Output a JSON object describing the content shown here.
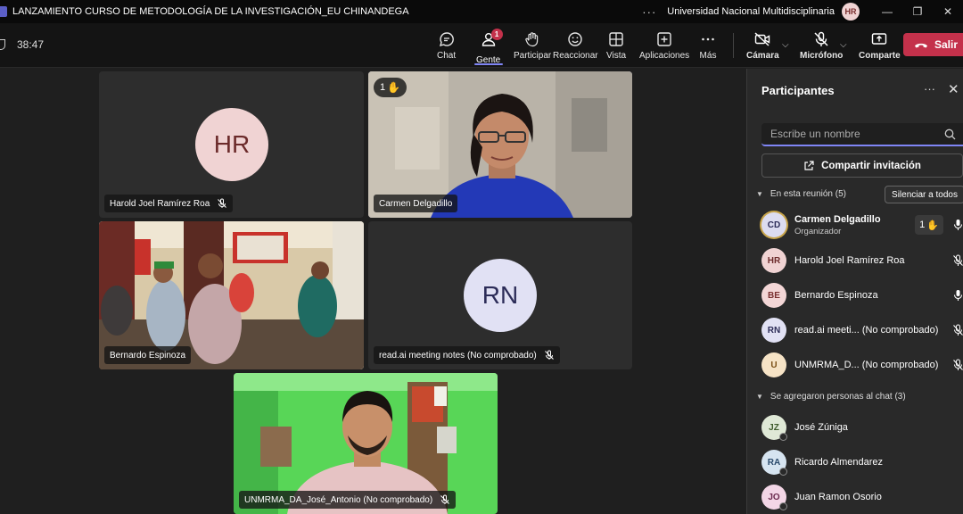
{
  "window": {
    "title": "LANZAMIENTO CURSO DE METODOLOGÍA DE LA INVESTIGACIÓN_EU CHINANDEGA",
    "more": "···",
    "org": "Universidad Nacional Multidisciplinaria",
    "user_initials": "HR",
    "minimize": "—",
    "restore": "❐",
    "close": "✕"
  },
  "toolbar": {
    "timer": "38:47",
    "chat": "Chat",
    "people": "Gente",
    "people_badge": "1",
    "raise": "Participar",
    "react": "Reaccionar",
    "view": "Vista",
    "apps": "Aplicaciones",
    "more": "Más",
    "camera": "Cámara",
    "mic": "Micrófono",
    "share": "Comparte",
    "leave": "Salir"
  },
  "stage": {
    "tiles": [
      {
        "name": "Harold Joel Ramírez Roa",
        "initials": "HR"
      },
      {
        "name": "Carmen Delgadillo",
        "hand": "1"
      },
      {
        "name": "Bernardo Espinoza"
      },
      {
        "name": "read.ai meeting notes (No comprobado)",
        "initials": "RN"
      },
      {
        "name": "UNMRMA_DA_José_Antonio (No comprobado)"
      }
    ]
  },
  "panel": {
    "title": "Participantes",
    "more": "···",
    "close": "✕",
    "search_placeholder": "Escribe un nombre",
    "share_invite": "Compartir invitación",
    "in_meeting": "En esta reunión (5)",
    "mute_all": "Silenciar a todos",
    "in_meeting_list": [
      {
        "initials": "CD",
        "name": "Carmen Delgadillo",
        "role": "Organizador",
        "hand": "1"
      },
      {
        "initials": "HR",
        "name": "Harold Joel Ramírez Roa"
      },
      {
        "initials": "BE",
        "name": "Bernardo Espinoza"
      },
      {
        "initials": "RN",
        "name": "read.ai meeti... (No comprobado)"
      },
      {
        "initials": "U",
        "name": "UNMRMA_D... (No comprobado)"
      }
    ],
    "chat_added": "Se agregaron personas al chat (3)",
    "chat_list": [
      {
        "initials": "JZ",
        "name": "José Zúniga"
      },
      {
        "initials": "RA",
        "name": "Ricardo Almendarez"
      },
      {
        "initials": "JO",
        "name": "Juan Ramon Osorio"
      }
    ]
  },
  "colors": {
    "accent": "#7f85f5",
    "leave": "#c4314b",
    "raise_hand": "#f5b041"
  }
}
